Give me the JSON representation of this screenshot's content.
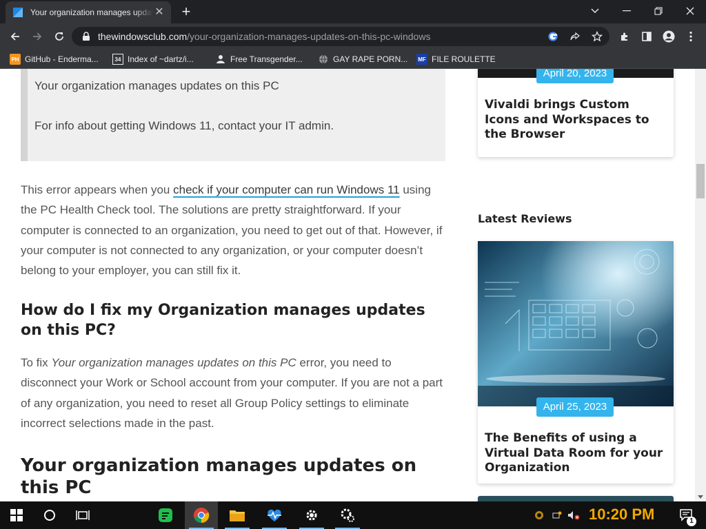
{
  "browser": {
    "tab_title": "Your organization manages updates on this PC",
    "url_host": "thewindowsclub.com",
    "url_path": "/your-organization-manages-updates-on-this-pc-windows",
    "bookmarks": [
      {
        "label": "GitHub - Enderma...",
        "icon": "ph-icon"
      },
      {
        "label": "Index of ~dartz/i...",
        "icon": "folder-icon"
      },
      {
        "label": "Free Transgender...",
        "icon": "person-icon"
      },
      {
        "label": "GAY RAPE PORN...",
        "icon": "globe-icon"
      },
      {
        "label": "FILE ROULETTE",
        "icon": "mf-icon"
      }
    ]
  },
  "article": {
    "quote_line1": "Your organization manages updates on this PC",
    "quote_line2": "For info about getting Windows 11, contact your IT admin.",
    "p1_before": "This error appears when you ",
    "p1_link": "check if your computer can run Windows 11",
    "p1_after": " using the PC Health Check tool. The solutions are pretty straightforward. If your computer is connected to an organization, you need to get out of that. However, if your computer is not connected to any organization, or your computer doesn’t belong to your employer, you can still fix it.",
    "h2_fix": "How do I fix my Organization manages updates on this PC?",
    "p2_before": "To fix ",
    "p2_em": "Your organization manages updates on this PC",
    "p2_after": " error, you need to disconnect your Work or School account from your computer. If you are not a part of any organization, you need to reset all Group Policy settings to eliminate incorrect selections made in the past.",
    "h2_title": "Your organization manages updates on this PC"
  },
  "sidebar": {
    "card1_date": "April 20, 2023",
    "card1_title": "Vivaldi brings Custom Icons and Workspaces to the Browser",
    "latest_reviews": "Latest Reviews",
    "card2_date": "April 25, 2023",
    "card2_title": "The Benefits of using a Virtual Data Room for your Organization"
  },
  "taskbar": {
    "clock": "10:20 PM",
    "notification_count": "1"
  },
  "colors": {
    "accent": "#34b4ec",
    "link_underline": "#21a1e1",
    "clock": "#f0a800"
  }
}
